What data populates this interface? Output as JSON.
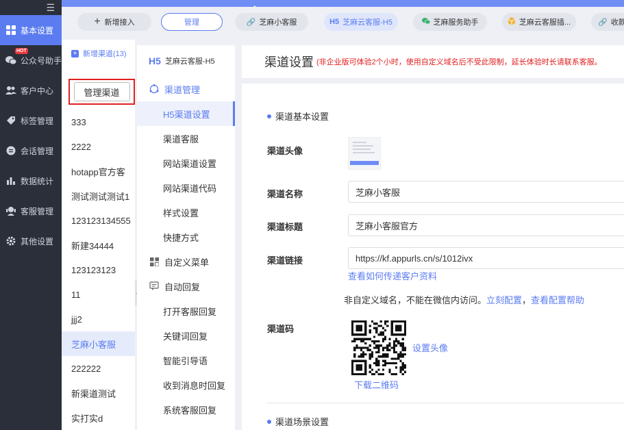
{
  "sidebar": {
    "items": [
      {
        "label": "基本设置",
        "icon": "grid-icon",
        "active": true
      },
      {
        "label": "公众号助手",
        "icon": "wechat-icon",
        "badge": "HOT"
      },
      {
        "label": "客户中心",
        "icon": "users-icon"
      },
      {
        "label": "标签管理",
        "icon": "tag-icon"
      },
      {
        "label": "会话管理",
        "icon": "chat-icon"
      },
      {
        "label": "数据统计",
        "icon": "chart-icon"
      },
      {
        "label": "客服管理",
        "icon": "agent-icon"
      },
      {
        "label": "其他设置",
        "icon": "gear-icon"
      }
    ]
  },
  "topbar": {
    "add_label": "新增接入",
    "manage_label": "管理",
    "channels": [
      {
        "label": "芝麻小客服",
        "icon": "link-icon"
      },
      {
        "label": "芝麻云客服-H5",
        "icon": "h5-icon",
        "active": true
      },
      {
        "label": "芝麻服务助手",
        "icon": "wechat-icon"
      },
      {
        "label": "芝麻云客服插...",
        "icon": "plugin-icon"
      },
      {
        "label": "收款的",
        "icon": "link-icon"
      }
    ]
  },
  "channel_list": {
    "new_label": "新增渠道(13)",
    "manage_button": "管理渠道",
    "items": [
      "333",
      "2222",
      "hotapp官方客",
      "测试测试测试1",
      "123123134555",
      "新建34444",
      "123123123",
      "11",
      "jjj2",
      "芝麻小客服",
      "222222",
      "新渠道测试",
      "实打实d"
    ],
    "active_index": 9
  },
  "submenu": {
    "h5_tag": "H5",
    "head_title": "芝麻云客服-H5",
    "groups": [
      {
        "label": "渠道管理",
        "icon": "channel-icon",
        "items": [
          "H5渠道设置",
          "渠道客服",
          "网站渠道设置",
          "网站渠道代码",
          "样式设置",
          "快捷方式"
        ]
      },
      {
        "label": "自定义菜单",
        "icon": "menu-icon",
        "items": []
      },
      {
        "label": "自动回复",
        "icon": "reply-icon",
        "items": [
          "打开客服回复",
          "关键词回复",
          "智能引导语",
          "收到消息时回复",
          "系统客服回复"
        ]
      }
    ],
    "active_item": "H5渠道设置"
  },
  "main": {
    "title": "渠道设置",
    "note": "(非企业版可体验2个小时，使用自定义域名后不受此限制，延长体验时长请联系客服。",
    "basic_section": "渠道基本设置",
    "avatar_label": "渠道头像",
    "name_label": "渠道名称",
    "name_value": "芝麻小客服",
    "title_label": "渠道标题",
    "title_value": "芝麻小客服官方",
    "link_label": "渠道链接",
    "link_value": "https://kf.appurls.cn/s/1012ivx",
    "pass_info_link": "查看如何传递客户资料",
    "domain_note": "非自定义域名，不能在微信内访问。",
    "config_now": "立刻配置",
    "comma": "，",
    "config_help": "查看配置帮助",
    "qr_label": "渠道码",
    "set_avatar": "设置头像",
    "download_qr": "下载二维码",
    "scene_section": "渠道场景设置"
  },
  "colors": {
    "accent": "#5b7cf0",
    "sidebar_bg": "#2b2f3a",
    "warning": "#e02020"
  }
}
